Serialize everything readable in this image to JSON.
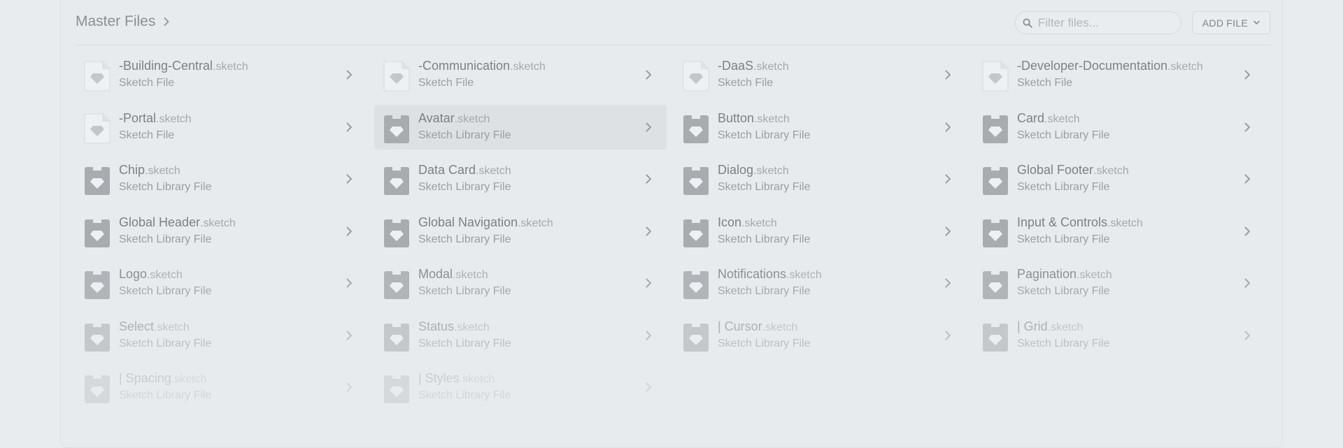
{
  "header": {
    "breadcrumb": "Master Files",
    "search_placeholder": "Filter files...",
    "add_button": "ADD FILE"
  },
  "files": [
    {
      "name": "-Building-Central",
      "ext": ".sketch",
      "type": "Sketch File"
    },
    {
      "name": "-Communication",
      "ext": ".sketch",
      "type": "Sketch File"
    },
    {
      "name": "-DaaS",
      "ext": ".sketch",
      "type": "Sketch File"
    },
    {
      "name": "-Developer-Documentation",
      "ext": ".sketch",
      "type": "Sketch File"
    },
    {
      "name": "-Portal",
      "ext": ".sketch",
      "type": "Sketch File"
    },
    {
      "name": "Avatar",
      "ext": ".sketch",
      "type": "Sketch Library File"
    },
    {
      "name": "Button",
      "ext": ".sketch",
      "type": "Sketch Library File"
    },
    {
      "name": "Card",
      "ext": ".sketch",
      "type": "Sketch Library File"
    },
    {
      "name": "Chip",
      "ext": ".sketch",
      "type": "Sketch Library File"
    },
    {
      "name": "Data Card",
      "ext": ".sketch",
      "type": "Sketch Library File"
    },
    {
      "name": "Dialog",
      "ext": ".sketch",
      "type": "Sketch Library File"
    },
    {
      "name": "Global Footer",
      "ext": ".sketch",
      "type": "Sketch Library File"
    },
    {
      "name": "Global Header",
      "ext": ".sketch",
      "type": "Sketch Library File"
    },
    {
      "name": "Global Navigation",
      "ext": ".sketch",
      "type": "Sketch Library File"
    },
    {
      "name": "Icon",
      "ext": ".sketch",
      "type": "Sketch Library File"
    },
    {
      "name": "Input & Controls",
      "ext": ".sketch",
      "type": "Sketch Library File"
    },
    {
      "name": "Logo",
      "ext": ".sketch",
      "type": "Sketch Library File"
    },
    {
      "name": "Modal",
      "ext": ".sketch",
      "type": "Sketch Library File"
    },
    {
      "name": "Notifications",
      "ext": ".sketch",
      "type": "Sketch Library File"
    },
    {
      "name": "Pagination",
      "ext": ".sketch",
      "type": "Sketch Library File"
    },
    {
      "name": "Select",
      "ext": ".sketch",
      "type": "Sketch Library File"
    },
    {
      "name": "Status",
      "ext": ".sketch",
      "type": "Sketch Library File"
    },
    {
      "name": "| Cursor",
      "ext": ".sketch",
      "type": "Sketch Library File"
    },
    {
      "name": "| Grid",
      "ext": ".sketch",
      "type": "Sketch Library File"
    },
    {
      "name": "| Spacing",
      "ext": ".sketch",
      "type": "Sketch Library File"
    },
    {
      "name": "| Styles",
      "ext": ".sketch",
      "type": "Sketch Library File"
    }
  ],
  "selected_file": "Avatar"
}
